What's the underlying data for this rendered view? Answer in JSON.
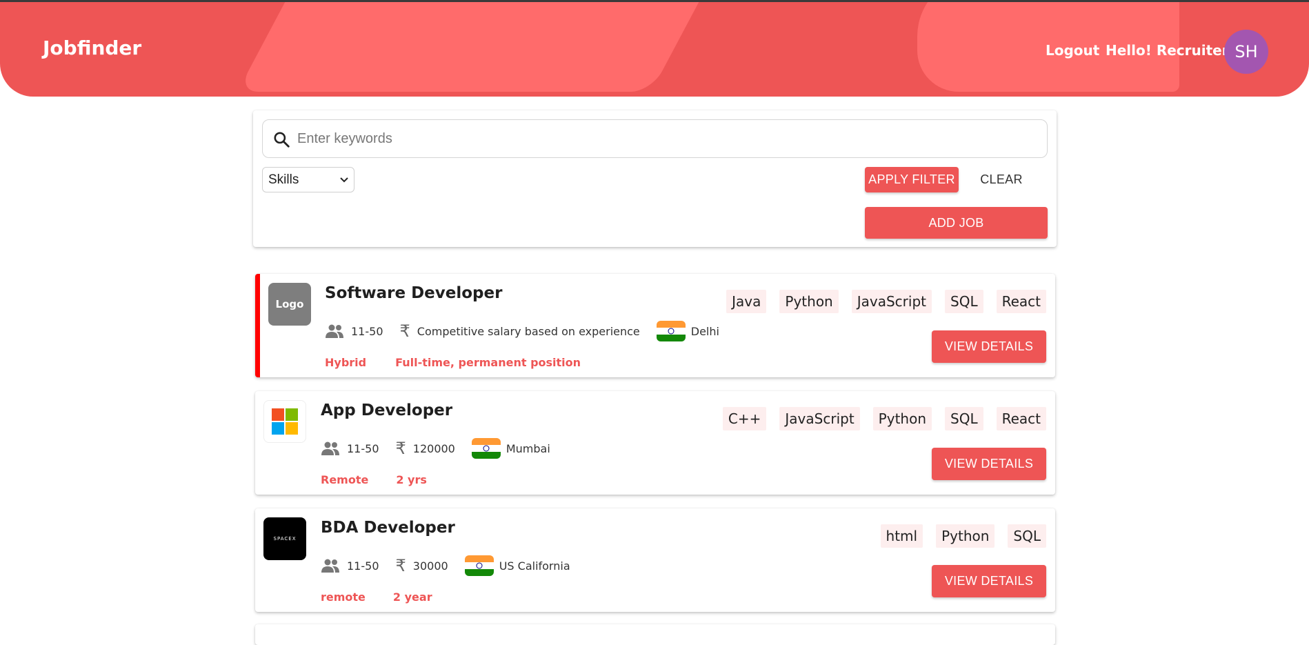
{
  "header": {
    "brand": "Jobfinder",
    "logout": "Logout",
    "greeting": "Hello! Recruiter",
    "avatar_initials": "SH"
  },
  "filter": {
    "search_placeholder": "Enter keywords",
    "skills_select_value": "Skills",
    "apply_button": "APPLY FILTER",
    "clear_button": "CLEAR",
    "add_job_button": "ADD JOB"
  },
  "jobs": [
    {
      "logo_text": "Logo",
      "title": "Software Developer",
      "team_size": "11-50",
      "salary": "Competitive salary based on experience",
      "location": "Delhi",
      "work_mode": "Hybrid",
      "job_type": "Full-time, permanent position",
      "skills": [
        "Java",
        "Python",
        "JavaScript",
        "SQL",
        "React"
      ],
      "view_button": "VIEW DETAILS"
    },
    {
      "logo_text": "",
      "title": "App Developer",
      "team_size": "11-50",
      "salary": "120000",
      "location": "Mumbai",
      "work_mode": "Remote",
      "job_type": "2 yrs",
      "skills": [
        "C++",
        "JavaScript",
        "Python",
        "SQL",
        "React"
      ],
      "view_button": "VIEW DETAILS"
    },
    {
      "logo_text": "SPACEX",
      "title": "BDA Developer",
      "team_size": "11-50",
      "salary": "30000",
      "location": "US California",
      "work_mode": "remote",
      "job_type": "2 year",
      "skills": [
        "html",
        "Python",
        "SQL"
      ],
      "view_button": "VIEW DETAILS"
    }
  ],
  "colors": {
    "accent": "#ee5555",
    "header_deco": "#ff6b6b",
    "avatar": "#a356b0",
    "active_border": "#ff0000",
    "tag_bg": "#fdeeee"
  }
}
